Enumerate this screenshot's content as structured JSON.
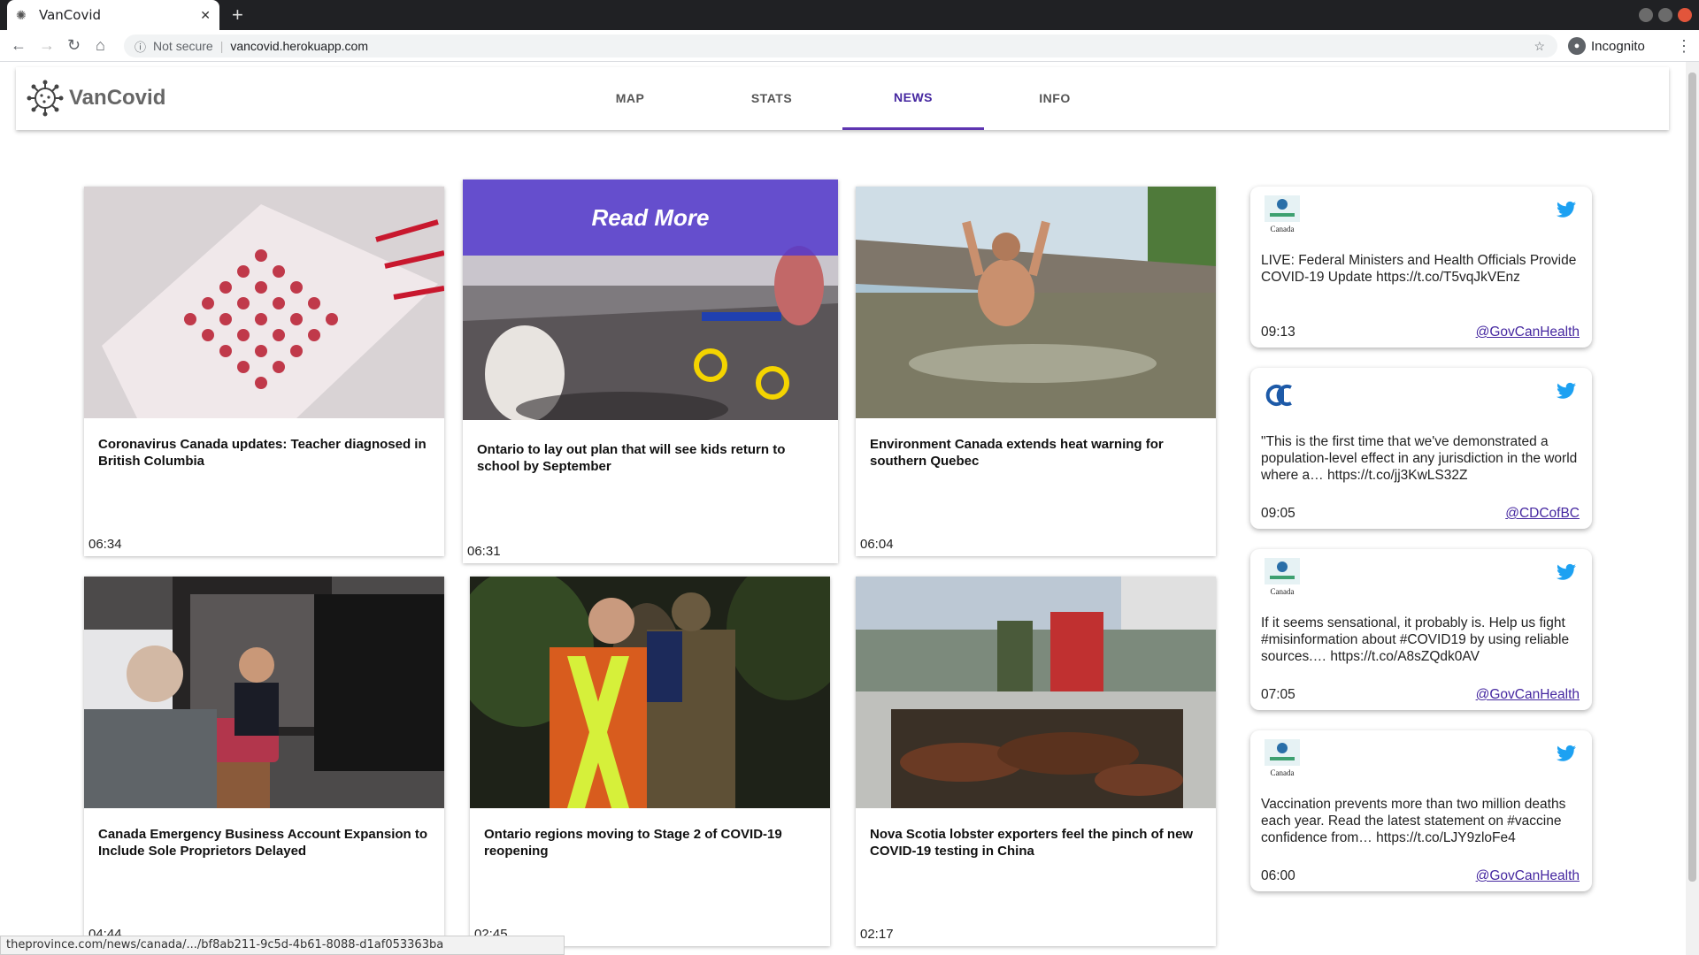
{
  "browser": {
    "tab_title": "VanCovid",
    "security": "Not secure",
    "url": "vancovid.herokuapp.com",
    "profile": "Incognito",
    "status_url": "theprovince.com/news/canada/.../bf8ab211-9c5d-4b61-8088-d1af053363ba"
  },
  "app": {
    "brand": "VanCovid",
    "nav": [
      {
        "label": "MAP"
      },
      {
        "label": "STATS"
      },
      {
        "label": "NEWS"
      },
      {
        "label": "INFO"
      }
    ],
    "active_tab": "NEWS",
    "accent": "#5e35b1"
  },
  "news": [
    {
      "headline": "Coronavirus Canada updates: Teacher diagnosed in British Columbia",
      "time": "06:34"
    },
    {
      "headline": "Ontario to lay out plan that will see kids return to school by September",
      "time": "06:31",
      "overlay": "Read More"
    },
    {
      "headline": "Environment Canada extends heat warning for southern Quebec",
      "time": "06:04"
    },
    {
      "headline": "Canada Emergency Business Account Expansion to Include Sole Proprietors Delayed",
      "time": "04:44"
    },
    {
      "headline": "Ontario regions moving to Stage 2 of COVID-19 reopening",
      "time": "02:45"
    },
    {
      "headline": "Nova Scotia lobster exporters feel the pinch of new COVID-19 testing in China",
      "time": "02:17"
    }
  ],
  "tweets": [
    {
      "text": "LIVE: Federal Ministers and Health Officials Provide COVID-19 Update https://t.co/T5vqJkVEnz",
      "time": "09:13",
      "handle": "@GovCanHealth",
      "avatar": "canada-logo"
    },
    {
      "text": "\"This is the first time that we've demonstrated a population-level effect in any jurisdiction in the world where a… https://t.co/jj3KwLS32Z",
      "time": "09:05",
      "handle": "@CDCofBC",
      "avatar": "cdc-logo"
    },
    {
      "text": "If it seems sensational, it probably is. Help us fight #misinformation about #COVID19 by using reliable sources.… https://t.co/A8sZQdk0AV",
      "time": "07:05",
      "handle": "@GovCanHealth",
      "avatar": "canada-logo"
    },
    {
      "text": "Vaccination prevents more than two million deaths each year. Read the latest statement on #vaccine confidence from… https://t.co/LJY9zloFe4",
      "time": "06:00",
      "handle": "@GovCanHealth",
      "avatar": "canada-logo"
    }
  ],
  "avatar_caption": "Canada"
}
